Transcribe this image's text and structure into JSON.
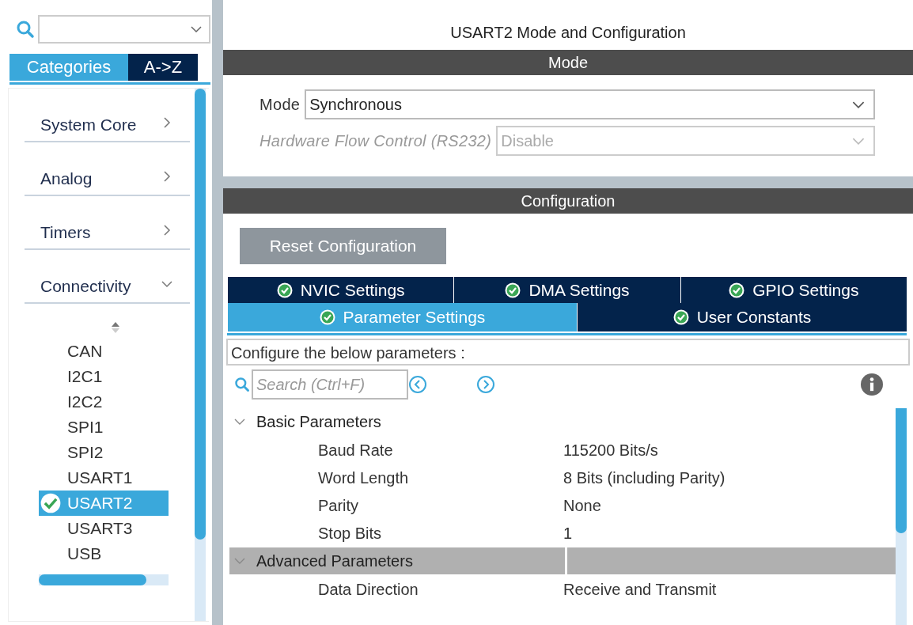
{
  "sidebar": {
    "tabs": [
      {
        "label": "Categories",
        "selected": true
      },
      {
        "label": "A->Z",
        "selected": false
      }
    ],
    "categories": [
      {
        "label": "System Core",
        "expanded": false
      },
      {
        "label": "Analog",
        "expanded": false
      },
      {
        "label": "Timers",
        "expanded": false
      },
      {
        "label": "Connectivity",
        "expanded": true
      }
    ],
    "peripherals": [
      {
        "label": "CAN",
        "selected": false,
        "checked": false
      },
      {
        "label": "I2C1",
        "selected": false,
        "checked": false
      },
      {
        "label": "I2C2",
        "selected": false,
        "checked": false
      },
      {
        "label": "SPI1",
        "selected": false,
        "checked": false
      },
      {
        "label": "SPI2",
        "selected": false,
        "checked": false
      },
      {
        "label": "USART1",
        "selected": false,
        "checked": false
      },
      {
        "label": "USART2",
        "selected": true,
        "checked": true
      },
      {
        "label": "USART3",
        "selected": false,
        "checked": false
      },
      {
        "label": "USB",
        "selected": false,
        "checked": false
      }
    ]
  },
  "main": {
    "title": "USART2 Mode and Configuration",
    "mode_header": "Mode",
    "mode_fields": [
      {
        "label": "Mode",
        "value": "Synchronous",
        "disabled": false
      },
      {
        "label": "Hardware Flow Control (RS232)",
        "value": "Disable",
        "disabled": true
      }
    ],
    "config_header": "Configuration",
    "reset_button": "Reset Configuration",
    "tab_rows": [
      [
        {
          "label": "NVIC Settings",
          "selected": false
        },
        {
          "label": "DMA Settings",
          "selected": false
        },
        {
          "label": "GPIO Settings",
          "selected": false
        }
      ],
      [
        {
          "label": "Parameter Settings",
          "selected": true
        },
        {
          "label": "User Constants",
          "selected": false
        }
      ]
    ],
    "description": "Configure the below parameters :",
    "search": {
      "placeholder": "Search (Ctrl+F)"
    },
    "groups": [
      {
        "label": "Basic Parameters",
        "expanded": true,
        "selected": false,
        "params": [
          {
            "name": "Baud Rate",
            "value": "115200 Bits/s"
          },
          {
            "name": "Word Length",
            "value": "8 Bits (including Parity)"
          },
          {
            "name": "Parity",
            "value": "None"
          },
          {
            "name": "Stop Bits",
            "value": "1"
          }
        ]
      },
      {
        "label": "Advanced Parameters",
        "expanded": true,
        "selected": true,
        "params": [
          {
            "name": "Data Direction",
            "value": "Receive and Transmit"
          }
        ]
      }
    ]
  }
}
